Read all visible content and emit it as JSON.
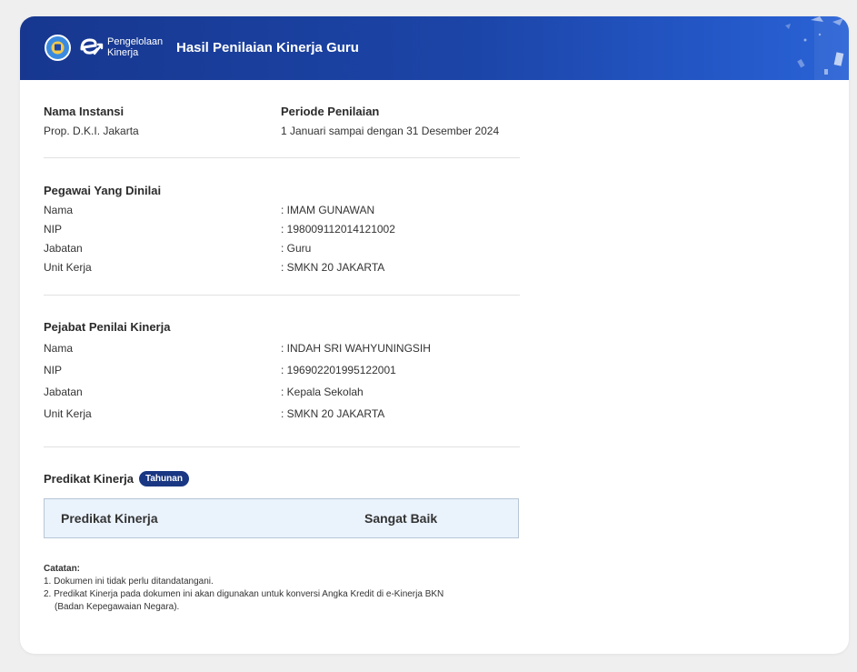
{
  "header": {
    "logo_line1": "Pengelolaan",
    "logo_line2": "Kinerja",
    "title": "Hasil Penilaian Kinerja Guru",
    "colors": {
      "bar_start": "#17378f",
      "bar_end": "#2a63d6",
      "badge": "#1a3783"
    }
  },
  "instansi": {
    "label": "Nama Instansi",
    "value": "Prop. D.K.I. Jakarta"
  },
  "periode": {
    "label": "Periode Penilaian",
    "value": "1 Januari sampai dengan 31 Desember 2024"
  },
  "pegawai": {
    "heading": "Pegawai Yang Dinilai",
    "rows": [
      {
        "key": "Nama",
        "value": ": IMAM GUNAWAN"
      },
      {
        "key": "NIP",
        "value": ": 198009112014121002"
      },
      {
        "key": "Jabatan",
        "value": ": Guru"
      },
      {
        "key": "Unit Kerja",
        "value": ": SMKN 20 JAKARTA"
      }
    ]
  },
  "pejabat": {
    "heading": "Pejabat Penilai Kinerja",
    "rows": [
      {
        "key": "Nama",
        "value": ": INDAH SRI WAHYUNINGSIH"
      },
      {
        "key": "NIP",
        "value": ": 196902201995122001"
      },
      {
        "key": "Jabatan",
        "value": ": Kepala Sekolah"
      },
      {
        "key": "Unit Kerja",
        "value": ": SMKN 20 JAKARTA"
      }
    ]
  },
  "predikat": {
    "heading": "Predikat Kinerja",
    "badge": "Tahunan",
    "box_label": "Predikat Kinerja",
    "box_value": "Sangat Baik"
  },
  "notes": {
    "heading": "Catatan:",
    "line1": "1. Dokumen ini tidak perlu ditandatangani.",
    "line2": "2. Predikat Kinerja pada dokumen ini akan digunakan untuk konversi Angka Kredit di e-Kinerja BKN",
    "line3": "(Badan Kepegawaian Negara)."
  }
}
